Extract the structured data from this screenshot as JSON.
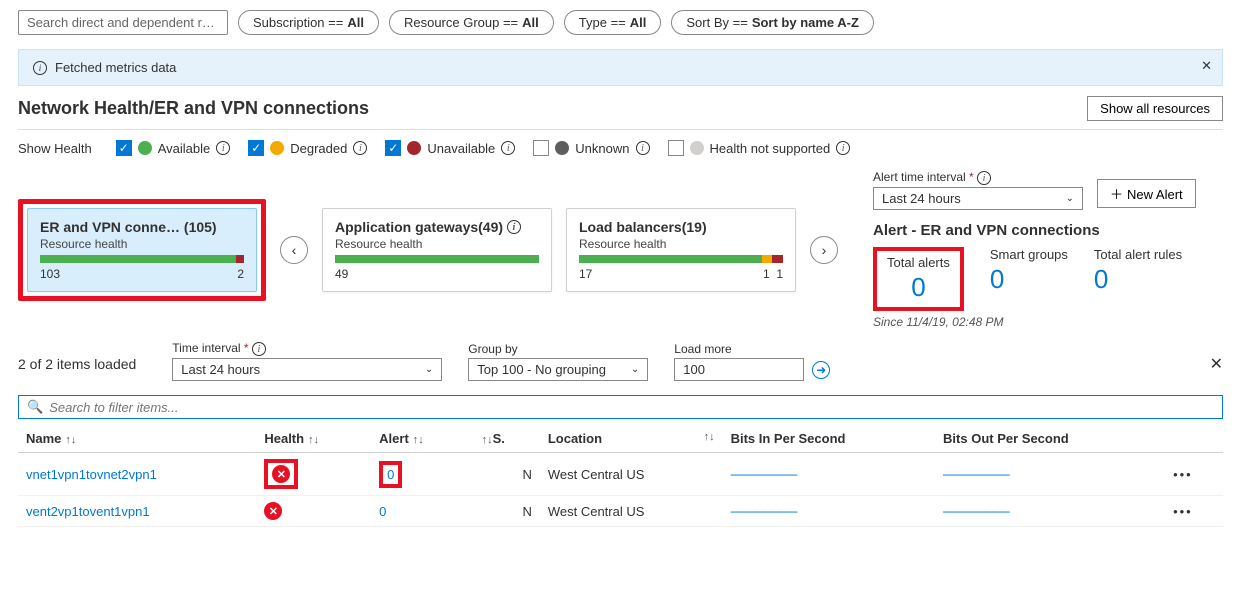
{
  "toolbar": {
    "search_placeholder": "Search direct and dependent reso…",
    "filters": [
      {
        "label": "Subscription == ",
        "value": "All"
      },
      {
        "label": "Resource Group == ",
        "value": "All"
      },
      {
        "label": "Type == ",
        "value": "All"
      },
      {
        "label": "Sort By == ",
        "value": "Sort by name A-Z"
      }
    ]
  },
  "banner": {
    "text": "Fetched metrics data"
  },
  "page_title": "Network Health/ER and VPN connections",
  "show_all_btn": "Show all resources",
  "show_health": {
    "label": "Show Health",
    "items": [
      {
        "label": "Available",
        "checked": true,
        "color": "green"
      },
      {
        "label": "Degraded",
        "checked": true,
        "color": "orange"
      },
      {
        "label": "Unavailable",
        "checked": true,
        "color": "red"
      },
      {
        "label": "Unknown",
        "checked": false,
        "color": "grey"
      },
      {
        "label": "Health not supported",
        "checked": false,
        "color": "lgrey"
      }
    ]
  },
  "cards": {
    "selected": {
      "title": "ER and VPN conne…  (105)",
      "sub": "Resource health",
      "left": "103",
      "right": "2"
    },
    "c2": {
      "title": "Application gateways(49)",
      "sub": "Resource health",
      "left": "49"
    },
    "c3": {
      "title": "Load balancers(19)",
      "sub": "Resource health",
      "left": "17",
      "mid": "1",
      "right": "1"
    }
  },
  "alerts": {
    "interval_label": "Alert time interval",
    "interval_value": "Last 24 hours",
    "new_alert_btn": "New Alert",
    "section_title": "Alert - ER and VPN connections",
    "cols": [
      {
        "label": "Total alerts",
        "value": "0"
      },
      {
        "label": "Smart groups",
        "value": "0"
      },
      {
        "label": "Total alert rules",
        "value": "0"
      }
    ],
    "since": "Since 11/4/19, 02:48 PM"
  },
  "controls": {
    "loaded": "2 of 2 items loaded",
    "time_label": "Time interval",
    "time_value": "Last 24 hours",
    "group_label": "Group by",
    "group_value": "Top 100 - No grouping",
    "load_label": "Load more",
    "load_value": "100"
  },
  "filter_placeholder": "Search to filter items...",
  "table": {
    "headers": {
      "name": "Name",
      "health": "Health",
      "alert": "Alert",
      "s": "S.",
      "location": "Location",
      "bin": "Bits In Per Second",
      "bout": "Bits Out Per Second"
    },
    "rows": [
      {
        "name": "vnet1vpn1tovnet2vpn1",
        "alert": "0",
        "s": "N",
        "location": "West Central US",
        "framed": true
      },
      {
        "name": "vent2vp1tovent1vpn1",
        "alert": "0",
        "s": "N",
        "location": "West Central US",
        "framed": false
      }
    ]
  },
  "chart_data": {
    "type": "bar",
    "title": "Resource health counts by category",
    "categories": [
      "ER and VPN connections",
      "Application gateways",
      "Load balancers"
    ],
    "series": [
      {
        "name": "Available",
        "values": [
          103,
          49,
          17
        ]
      },
      {
        "name": "Degraded",
        "values": [
          0,
          0,
          1
        ]
      },
      {
        "name": "Unavailable",
        "values": [
          2,
          0,
          1
        ]
      }
    ],
    "totals": [
      105,
      49,
      19
    ]
  }
}
